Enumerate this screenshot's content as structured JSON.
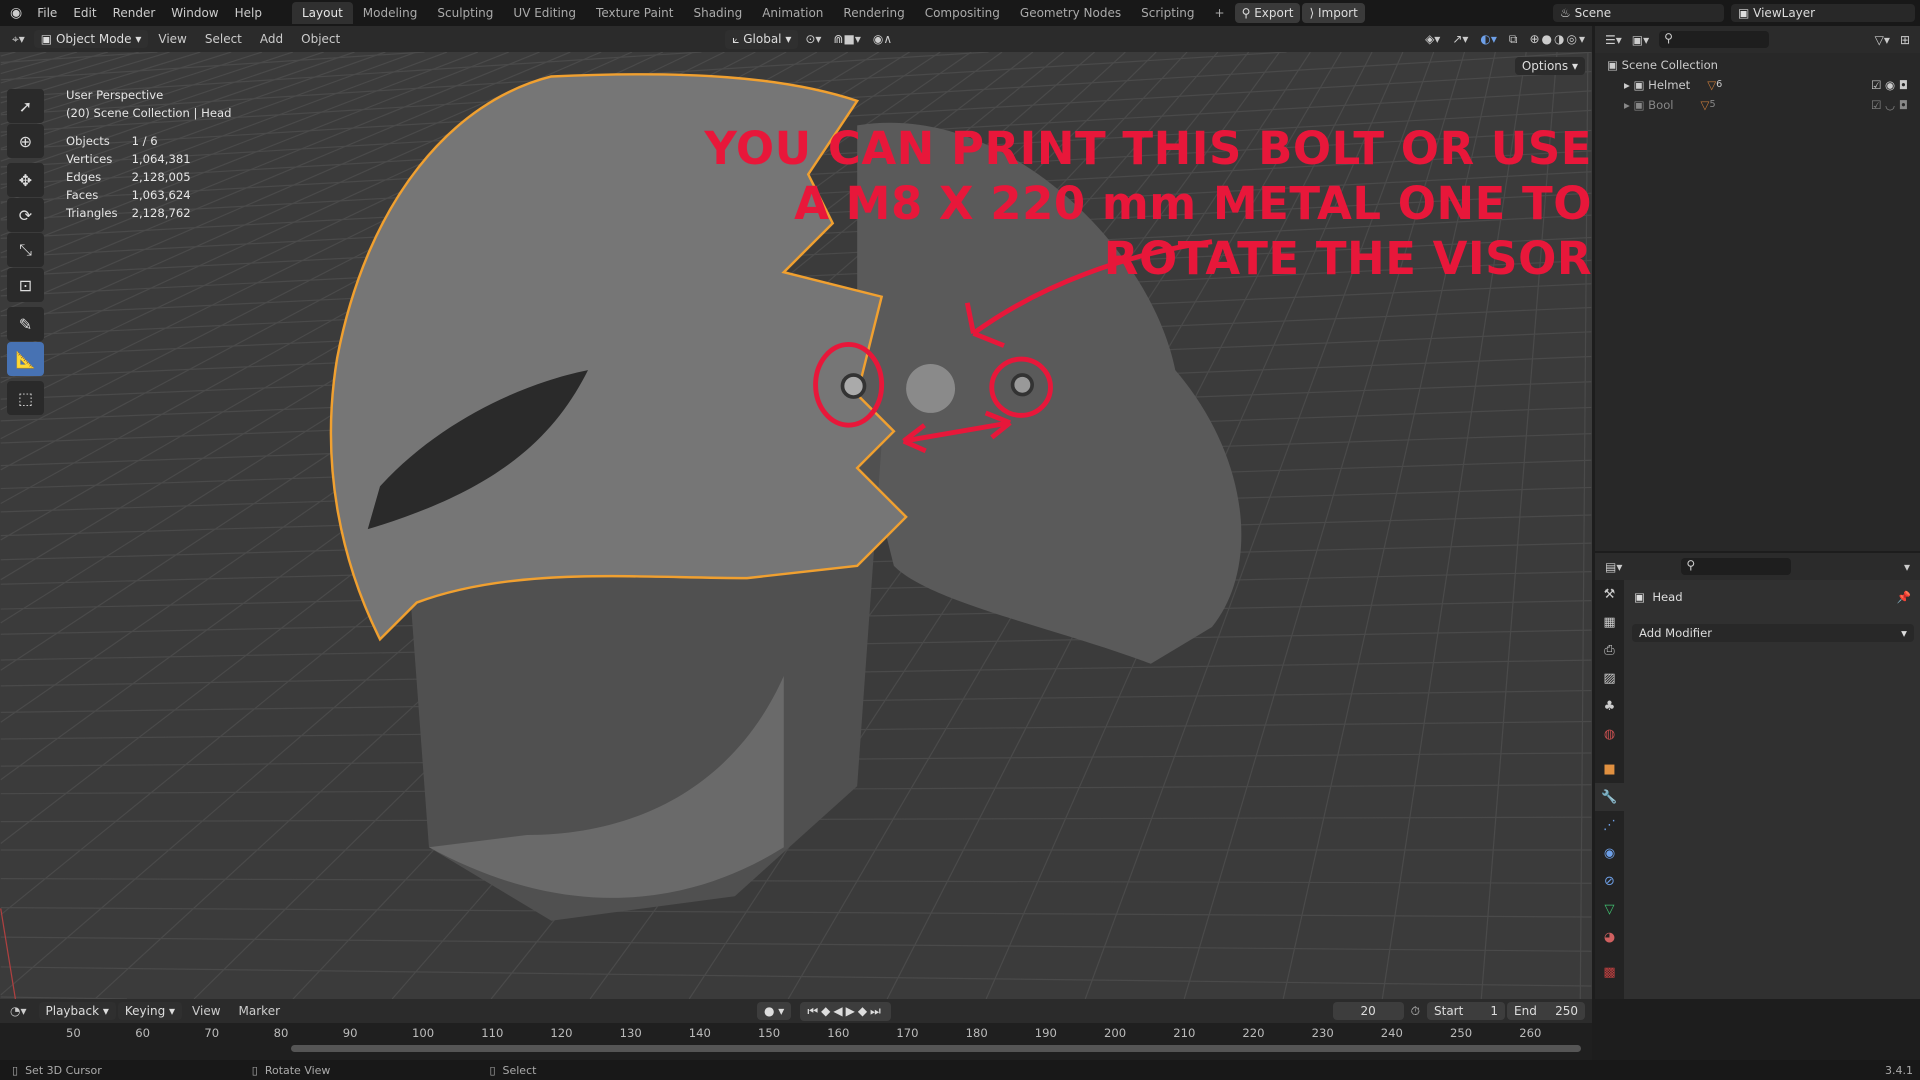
{
  "topbar": {
    "menus": [
      "File",
      "Edit",
      "Render",
      "Window",
      "Help"
    ],
    "workspaces": [
      "Layout",
      "Modeling",
      "Sculpting",
      "UV Editing",
      "Texture Paint",
      "Shading",
      "Animation",
      "Rendering",
      "Compositing",
      "Geometry Nodes",
      "Scripting"
    ],
    "active_workspace": "Layout",
    "add_label": "+",
    "export_label": "Export",
    "import_label": "Import",
    "scene": "Scene",
    "view_layer": "ViewLayer"
  },
  "viewport_header": {
    "mode": "Object Mode",
    "menus": [
      "View",
      "Select",
      "Add",
      "Object"
    ],
    "orientation": "Global",
    "options": "Options"
  },
  "overlay": {
    "perspective": "User Perspective",
    "collection": "(20) Scene Collection | Head",
    "stats": [
      {
        "label": "Objects",
        "value": "1 / 6"
      },
      {
        "label": "Vertices",
        "value": "1,064,381"
      },
      {
        "label": "Edges",
        "value": "2,128,005"
      },
      {
        "label": "Faces",
        "value": "1,063,624"
      },
      {
        "label": "Triangles",
        "value": "2,128,762"
      }
    ]
  },
  "annotation": {
    "lines": [
      "YOU CAN PRINT THIS BOLT OR USE",
      "A M8 X 220 mm METAL ONE TO",
      "ROTATE THE VISOR"
    ],
    "color": "#e8173a"
  },
  "outliner": {
    "root": "Scene Collection",
    "items": [
      {
        "name": "Helmet",
        "count": "6"
      },
      {
        "name": "Bool",
        "count": "5"
      }
    ]
  },
  "properties": {
    "object": "Head",
    "add_modifier": "Add Modifier",
    "active_tab": "modifier"
  },
  "timeline": {
    "menus": [
      "Playback",
      "Keying",
      "View",
      "Marker"
    ],
    "current_frame": "20",
    "start_label": "Start",
    "start": "1",
    "end_label": "End",
    "end": "250",
    "ticks": [
      "50",
      "60",
      "70",
      "80",
      "90",
      "100",
      "110",
      "120",
      "130",
      "140",
      "150",
      "160",
      "170",
      "180",
      "190",
      "200",
      "210",
      "220",
      "230",
      "240",
      "250",
      "260"
    ]
  },
  "status": {
    "hints": [
      "Set 3D Cursor",
      "Rotate View",
      "Select"
    ],
    "version": "3.4.1"
  },
  "colors": {
    "selection_outline": "#f0a030",
    "accent": "#4772b3"
  }
}
